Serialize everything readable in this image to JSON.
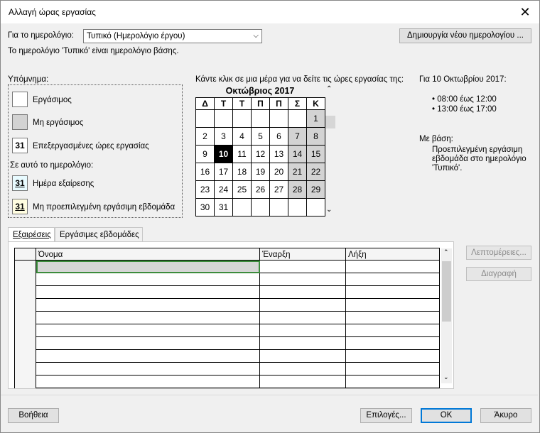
{
  "window": {
    "title": "Αλλαγή ώρας εργασίας"
  },
  "calendar_select": {
    "label": "Για το ημερολόγιο:",
    "value": "Τυπικό (Ημερολόγιο έργου)"
  },
  "new_calendar_button": "Δημιουργία νέου ημερολογίου ...",
  "base_note": "Το ημερολόγιο 'Τυπικό' είναι ημερολόγιο βάσης.",
  "legend": {
    "title": "Υπόμνημα:",
    "working": "Εργάσιμος",
    "nonworking": "Μη εργάσιμος",
    "edited": "Επεξεργασμένες ώρες εργασίας",
    "section": "Σε αυτό το ημερολόγιο:",
    "exception": "Ημέρα εξαίρεσης",
    "nondefault": "Μη προεπιλεγμένη εργάσιμη εβδομάδα",
    "sample": "31"
  },
  "calendar": {
    "instruction": "Κάντε κλικ σε μια μέρα για να δείτε τις ώρες εργασίας της:",
    "month": "Οκτώβριος 2017",
    "weekdays": [
      "Δ",
      "Τ",
      "Τ",
      "Π",
      "Π",
      "Σ",
      "Κ"
    ],
    "weeks": [
      [
        "",
        "",
        "",
        "",
        "",
        "",
        "1"
      ],
      [
        "2",
        "3",
        "4",
        "5",
        "6",
        "7",
        "8"
      ],
      [
        "9",
        "10",
        "11",
        "12",
        "13",
        "14",
        "15"
      ],
      [
        "16",
        "17",
        "18",
        "19",
        "20",
        "21",
        "22"
      ],
      [
        "23",
        "24",
        "25",
        "26",
        "27",
        "28",
        "29"
      ],
      [
        "30",
        "31",
        "",
        "",
        "",
        "",
        ""
      ]
    ],
    "selected_day": "10"
  },
  "info": {
    "date_title": "Για 10 Οκτωβρίου 2017:",
    "hours": [
      "• 08:00 έως 12:00",
      "• 13:00 έως 17:00"
    ],
    "based_on_label": "Με βάση:",
    "based_on_text": [
      "Προεπιλεγμένη εργάσιμη",
      "εβδομάδα στο ημερολόγιο",
      "'Τυπικό'."
    ]
  },
  "tabs": [
    "Εξαιρέσεις",
    "Εργάσιμες εβδομάδες"
  ],
  "table": {
    "columns": [
      "Όνομα",
      "Έναρξη",
      "Λήξη"
    ]
  },
  "side_buttons": {
    "details": "Λεπτομέρειες...",
    "delete": "Διαγραφή"
  },
  "footer": {
    "help": "Βοήθεια",
    "options": "Επιλογές...",
    "ok": "OK",
    "cancel": "Άκυρο"
  }
}
